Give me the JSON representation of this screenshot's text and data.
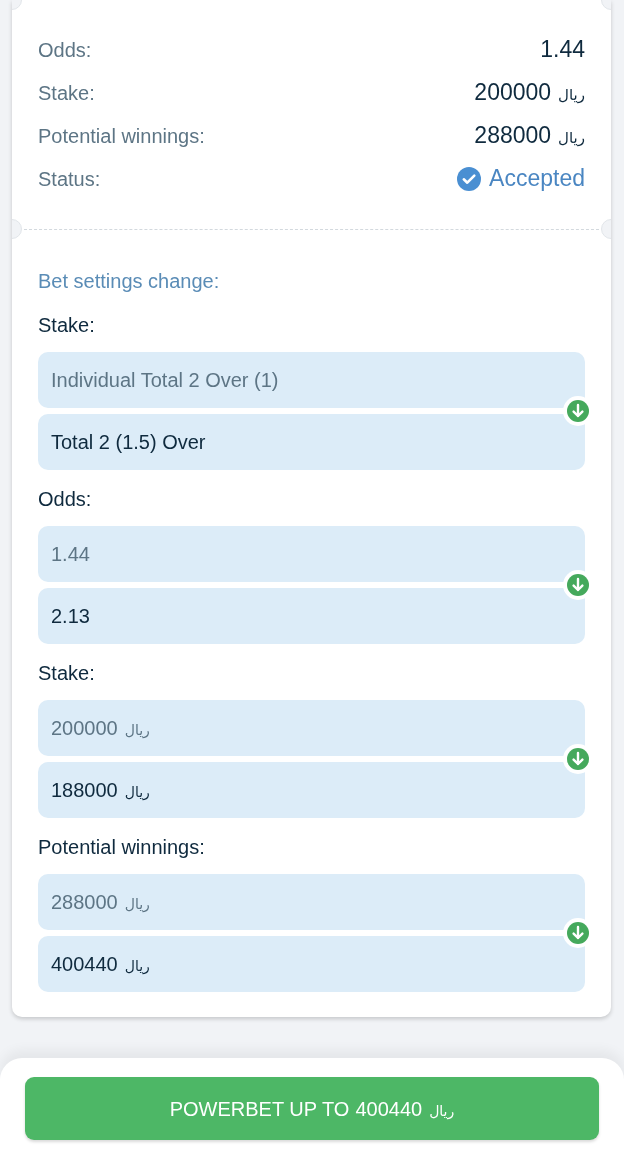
{
  "summary": {
    "rows": [
      {
        "kind": "plain",
        "label": "Odds:",
        "value": "1.44"
      },
      {
        "kind": "money",
        "label": "Stake:",
        "value": "200000",
        "currency": "ریال"
      },
      {
        "kind": "money",
        "label": "Potential winnings:",
        "value": "288000",
        "currency": "ریال"
      },
      {
        "kind": "status",
        "label": "Status:",
        "value": "Accepted"
      }
    ]
  },
  "bet_settings_change": {
    "title": "Bet settings change:",
    "groups": [
      {
        "label": "Stake:",
        "old": {
          "value": "Individual Total 2 Over (1)"
        },
        "new": {
          "value": "Total 2 (1.5) Over"
        }
      },
      {
        "label": "Odds:",
        "old": {
          "value": "1.44"
        },
        "new": {
          "value": "2.13"
        }
      },
      {
        "label": "Stake:",
        "old": {
          "value": "200000",
          "currency": "ریال"
        },
        "new": {
          "value": "188000",
          "currency": "ریال"
        }
      },
      {
        "label": "Potential winnings:",
        "old": {
          "value": "288000",
          "currency": "ریال"
        },
        "new": {
          "value": "400440",
          "currency": "ریال"
        }
      }
    ]
  },
  "powerbet_button": {
    "label": "POWERBET UP TO",
    "amount": "400440",
    "currency": "ریال"
  }
}
